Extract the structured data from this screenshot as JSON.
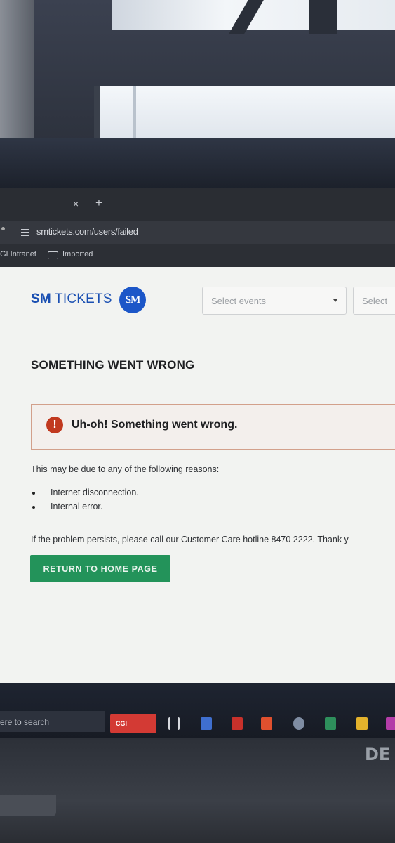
{
  "browser": {
    "tab_close_glyph": "×",
    "new_tab_glyph": "+",
    "url": "smtickets.com/users/failed",
    "bookmarks": [
      "GI Intranet",
      "Imported"
    ]
  },
  "header": {
    "logo_bold": "SM",
    "logo_rest": " TICKETS",
    "logo_mark": "SM",
    "select_events_placeholder": "Select events",
    "select_second_placeholder": "Select"
  },
  "main": {
    "title": "SOMETHING WENT WRONG",
    "alert_icon_glyph": "!",
    "alert_message": "Uh-oh! Something went wrong.",
    "reasons_intro": "This may be due to any of the following reasons:",
    "reasons": [
      "Internet disconnection.",
      "Internal error."
    ],
    "persist_message": "If the problem persists, please call our Customer Care hotline 8470 2222. Thank y",
    "home_button": "RETURN TO HOME PAGE"
  },
  "taskbar": {
    "search_text": "ere to search",
    "pinned_app_label": "CGI",
    "icons": [
      "task-view-icon",
      "file-icon",
      "red-app-icon",
      "office-icon",
      "weather-icon",
      "green-app-icon",
      "folder-icon",
      "app-icon"
    ]
  },
  "laptop": {
    "brand": "DE"
  },
  "colors": {
    "brand_blue": "#1a4fb2",
    "alert_red": "#c1391f",
    "button_green": "#23935a"
  }
}
